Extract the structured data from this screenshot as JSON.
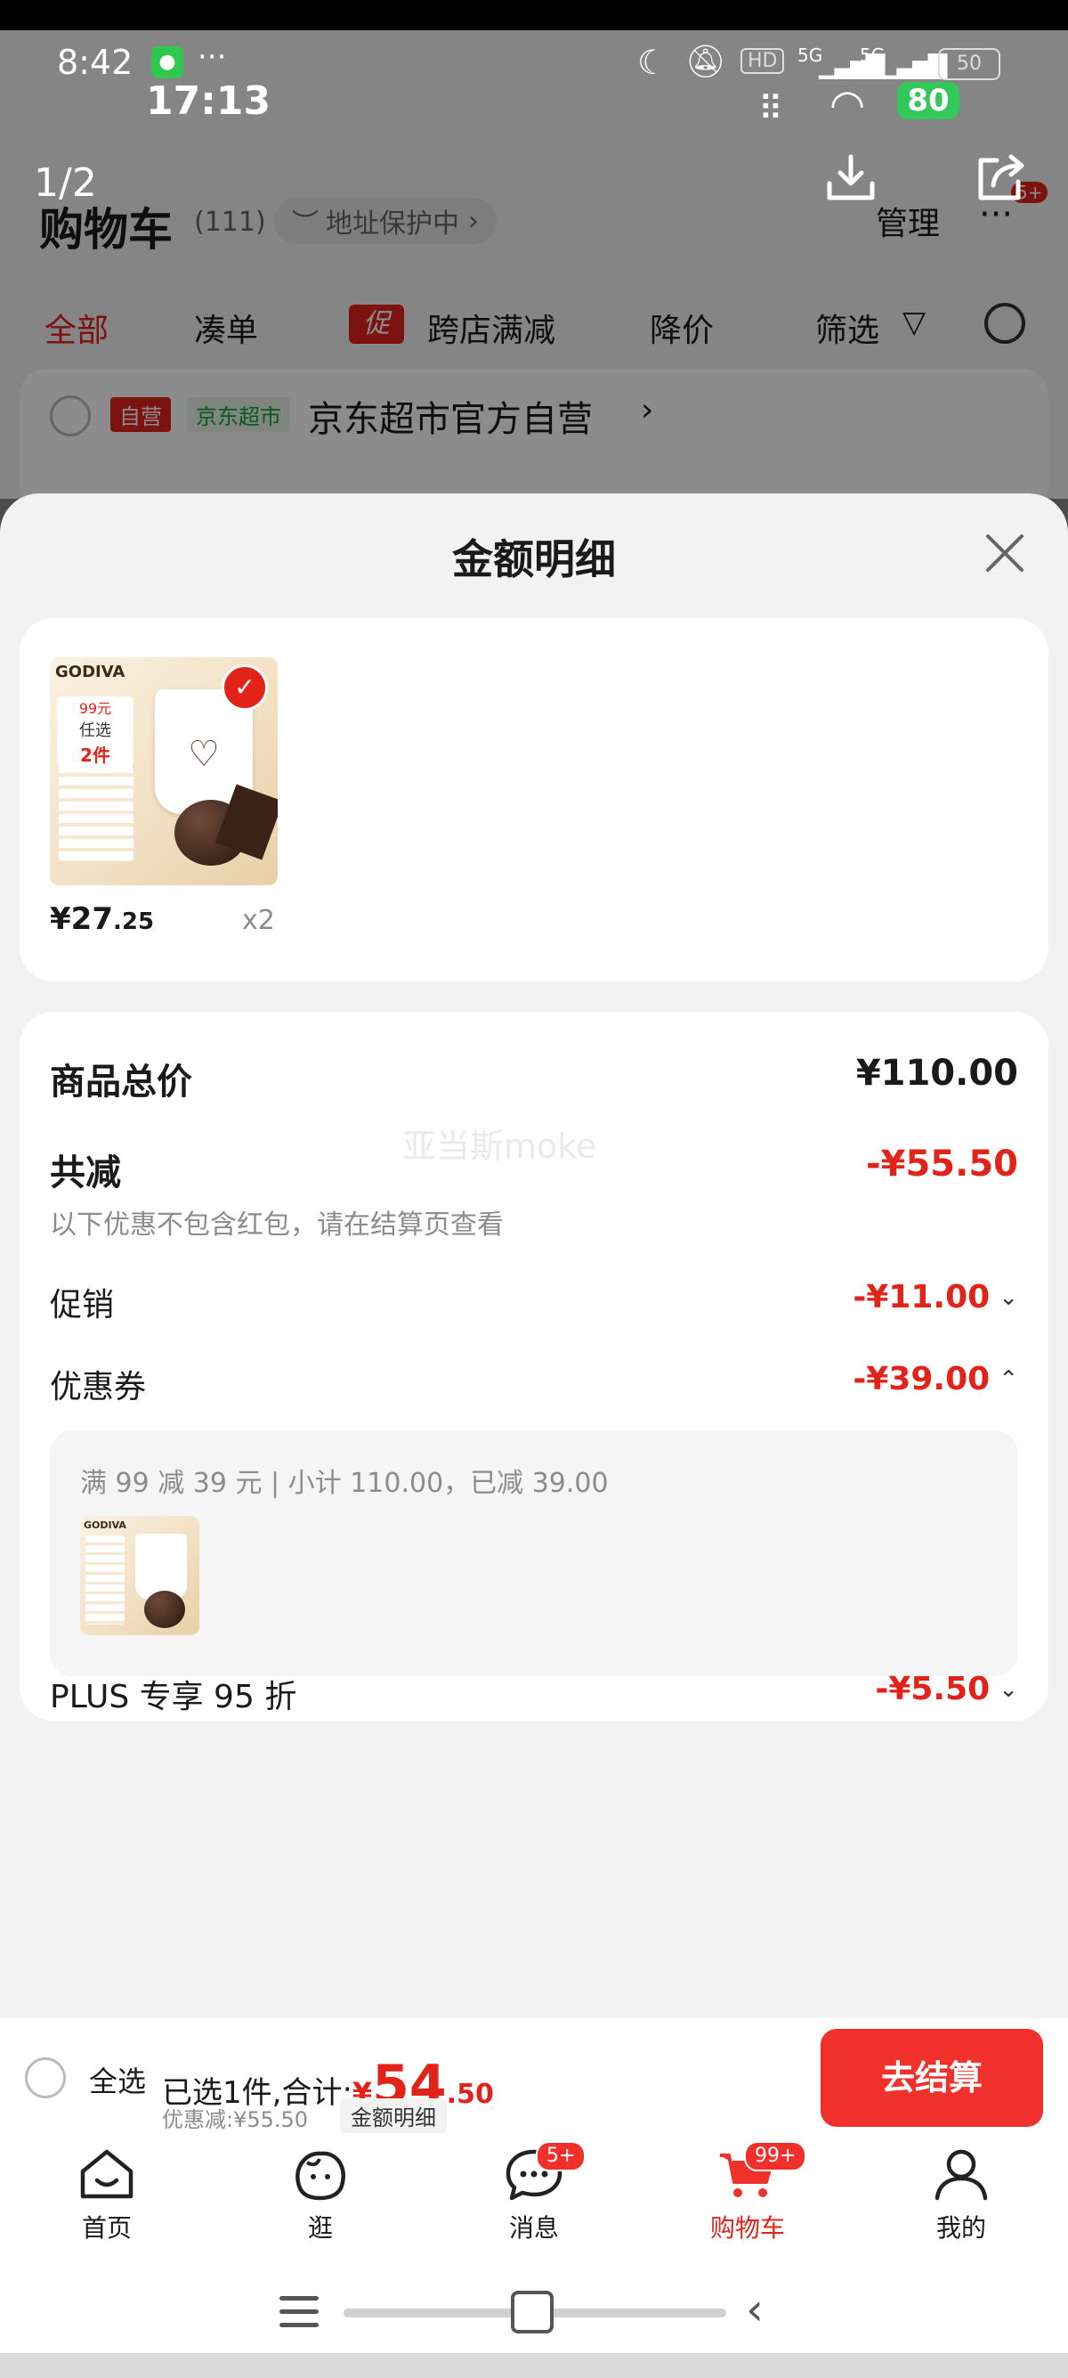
{
  "status_bar": {
    "time": "8:42",
    "dots": "···",
    "time2": "17:13",
    "battery": "50",
    "battery2": "80",
    "hd": "HD",
    "net": "5G"
  },
  "viewer": {
    "counter": "1/2"
  },
  "background_page": {
    "title": "购物车",
    "count": "(111)",
    "address_protect": "地址保护中",
    "manage": "管理",
    "more_badge": "5+",
    "filters": [
      "全部",
      "凑单",
      "跨店满减",
      "降价",
      "筛选"
    ],
    "promo_tag": "促",
    "store_tag_self": "自营",
    "store_tag_market": "京东超市",
    "store_name": "京东超市官方自营"
  },
  "sheet": {
    "title": "金额明细",
    "product": {
      "price_main": "¥27",
      "price_decimal": ".25",
      "qty": "x2",
      "brand": "GODIVA",
      "promo_text_a": "99元",
      "promo_text_b": "任选",
      "promo_text_c": "2件"
    },
    "summary": {
      "total_label": "商品总价",
      "total_value": "¥110.00",
      "reduce_label": "共减",
      "reduce_value": "-¥55.50",
      "note": "以下优惠不包含红包，请在结算页查看",
      "promo_label": "促销",
      "promo_value": "-¥11.00",
      "coupon_label": "优惠券",
      "coupon_value": "-¥39.00",
      "coupon_detail": "满 99 减 39 元 | 小计 110.00，已减 39.00",
      "plus_label": "PLUS 专享 95 折",
      "plus_value": "-¥5.50",
      "watermark": "亚当斯moke"
    }
  },
  "checkout": {
    "select_all": "全选",
    "selected_text": "已选1件,合计:",
    "currency": "¥",
    "total_int": "54",
    "total_dec": ".50",
    "discount_text": "优惠减:¥55.50",
    "detail_btn": "金额明细",
    "checkout_btn": "去结算"
  },
  "tabs": [
    {
      "label": "首页"
    },
    {
      "label": "逛"
    },
    {
      "label": "消息",
      "badge": "5+"
    },
    {
      "label": "购物车",
      "badge": "99+"
    },
    {
      "label": "我的"
    }
  ],
  "colors": {
    "accent": "#e2231a",
    "checkout_btn": "#f0302a"
  }
}
